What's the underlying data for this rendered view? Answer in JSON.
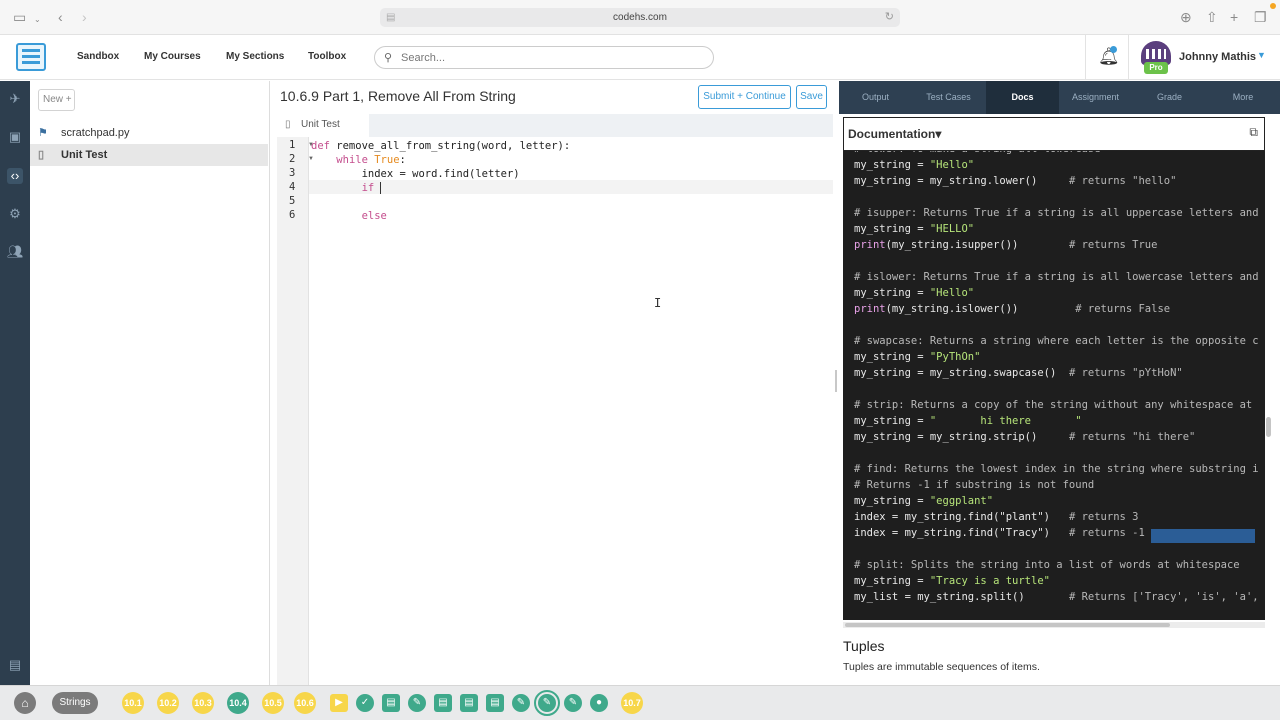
{
  "browser": {
    "url": "codehs.com"
  },
  "topnav": {
    "links": [
      "Sandbox",
      "My Courses",
      "My Sections",
      "Toolbox"
    ],
    "search_placeholder": "Search...",
    "user_name": "Johnny Mathis",
    "avatar_badge": "Pro"
  },
  "sidebar": {
    "new_button": "New +",
    "files": [
      {
        "name": "scratchpad.py",
        "selected": false
      },
      {
        "name": "Unit Test",
        "selected": true
      }
    ]
  },
  "editor": {
    "exercise_title": "10.6.9 Part 1, Remove All From String",
    "submit_label": "Submit + Continue",
    "save_label": "Save",
    "tab_label": "Unit Test",
    "line_numbers": [
      "1",
      "2",
      "3",
      "4",
      "5",
      "6"
    ],
    "lines": [
      "def remove_all_from_string(word, letter):",
      "    while True:",
      "        index = word.find(letter)",
      "        if ",
      "",
      "        else"
    ]
  },
  "right_panel": {
    "tabs": [
      "Output",
      "Test Cases",
      "Docs",
      "Assignment",
      "Grade",
      "More"
    ],
    "active_tab": "Docs",
    "docs_title": "Documentation",
    "doc_lines": [
      "# lower: To make a string all lowercase",
      "my_string = \"Hello\"",
      "my_string = my_string.lower()     # returns \"hello\"",
      "",
      "# isupper: Returns True if a string is all uppercase letters and",
      "my_string = \"HELLO\"",
      "print(my_string.isupper())        # returns True",
      "",
      "# islower: Returns True if a string is all lowercase letters and",
      "my_string = \"Hello\"",
      "print(my_string.islower())         # returns False",
      "",
      "# swapcase: Returns a string where each letter is the opposite c",
      "my_string = \"PyThOn\"",
      "my_string = my_string.swapcase()  # returns \"pYtHoN\"",
      "",
      "# strip: Returns a copy of the string without any whitespace at",
      "my_string = \"       hi there       \"",
      "my_string = my_string.strip()     # returns \"hi there\"",
      "",
      "# find: Returns the lowest index in the string where substring i",
      "# Returns -1 if substring is not found",
      "my_string = \"eggplant\"",
      "index = my_string.find(\"plant\")   # returns 3",
      "index = my_string.find(\"Tracy\")   # returns -1",
      "",
      "# split: Splits the string into a list of words at whitespace",
      "my_string = \"Tracy is a turtle\"",
      "my_list = my_string.split()       # Returns ['Tracy', 'is', 'a',"
    ],
    "tuples_heading": "Tuples",
    "tuples_text": "Tuples are immutable sequences of items."
  },
  "bottom_bar": {
    "unit_label": "Strings",
    "lessons": [
      "10.1",
      "10.2",
      "10.3",
      "10.4",
      "10.5",
      "10.6",
      "10.7"
    ]
  },
  "colors": {
    "accent": "#3a9bd8",
    "nav_dark": "#2e4052",
    "lesson_yellow": "#f7d64a",
    "lesson_green": "#3fa98b"
  }
}
